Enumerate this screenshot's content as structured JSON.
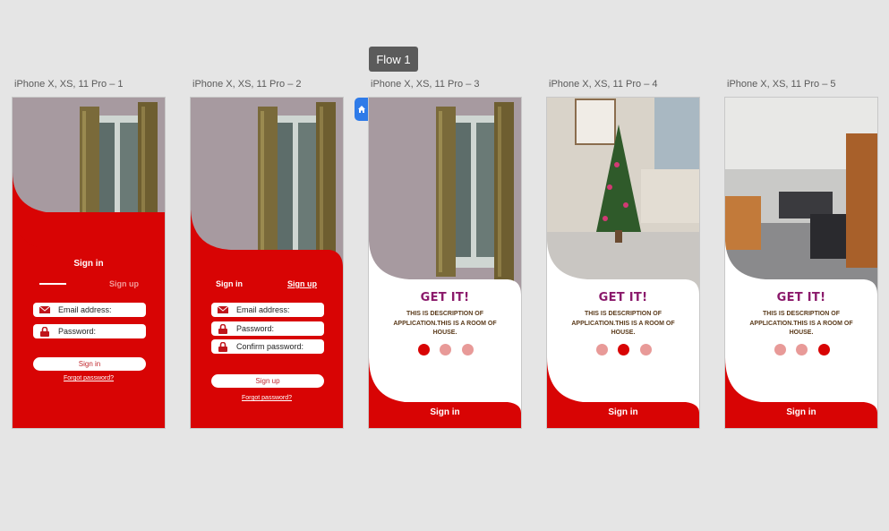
{
  "flow": {
    "label": "Flow 1"
  },
  "artboards": [
    {
      "label": "iPhone X, XS, 11 Pro – 1"
    },
    {
      "label": "iPhone X, XS, 11 Pro – 2"
    },
    {
      "label": "iPhone X, XS, 11 Pro – 3"
    },
    {
      "label": "iPhone X, XS, 11 Pro – 4"
    },
    {
      "label": "iPhone X, XS, 11 Pro – 5"
    }
  ],
  "screen1": {
    "heading": "Sign in",
    "tab_signup": "Sign up",
    "email_placeholder": "Email  address:",
    "password_placeholder": "Password:",
    "signin_button": "Sign in",
    "forgot": "Forgot password?"
  },
  "screen2": {
    "tab_signin": "Sign in",
    "tab_signup": "Sign up",
    "email_placeholder": "Email  address:",
    "password_placeholder": "Password:",
    "confirm_placeholder": "Confirm password:",
    "signup_button": "Sign up",
    "forgot": "Forgot password?"
  },
  "onboarding": {
    "title": "GET IT!",
    "description": "THIS IS DESCRIPTION OF APPLICATION.THIS IS A ROOM OF HOUSE.",
    "signin": "Sign in",
    "pages": [
      {
        "active_dot": 1
      },
      {
        "active_dot": 2
      },
      {
        "active_dot": 3
      }
    ]
  },
  "colors": {
    "red": "#d80404",
    "dot_inactive": "#e89a98",
    "title": "#8b1a6b",
    "flow_badge": "#5b5b5b",
    "home_marker": "#2f7be8"
  },
  "icons": [
    "home-icon",
    "mail-icon",
    "lock-icon"
  ]
}
